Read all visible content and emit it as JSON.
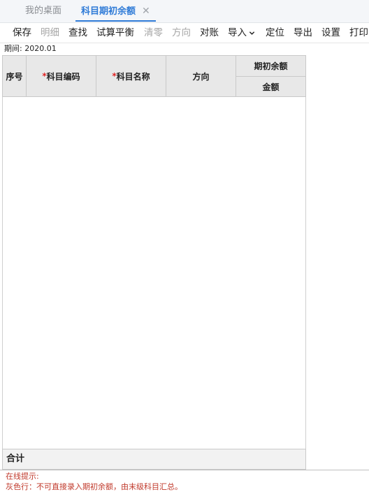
{
  "tabs": [
    {
      "label": "我的桌面"
    },
    {
      "label": "科目期初余额",
      "close": "✕"
    }
  ],
  "toolbar": {
    "save": "保存",
    "detail": "明细",
    "find": "查找",
    "trial_balance": "试算平衡",
    "clear": "清零",
    "direction": "方向",
    "reconcile": "对账",
    "import": "导入",
    "locate": "定位",
    "export": "导出",
    "settings": "设置",
    "print": "打印"
  },
  "period": {
    "label": "期间: 2020.01"
  },
  "table": {
    "headers": {
      "seq": "序号",
      "required_mark": "*",
      "code": "科目编码",
      "name": "科目名称",
      "direction": "方向",
      "opening_balance": "期初余额",
      "amount": "金额"
    },
    "total_label": "合计"
  },
  "hint": {
    "title": "在线提示:",
    "text": "灰色行：不可直接录入期初余额，由末级科目汇总。"
  },
  "colors": {
    "accent": "#2f7bd7",
    "header_bg": "#e8e8e8",
    "required": "#e02424",
    "hint": "#c0392b"
  }
}
